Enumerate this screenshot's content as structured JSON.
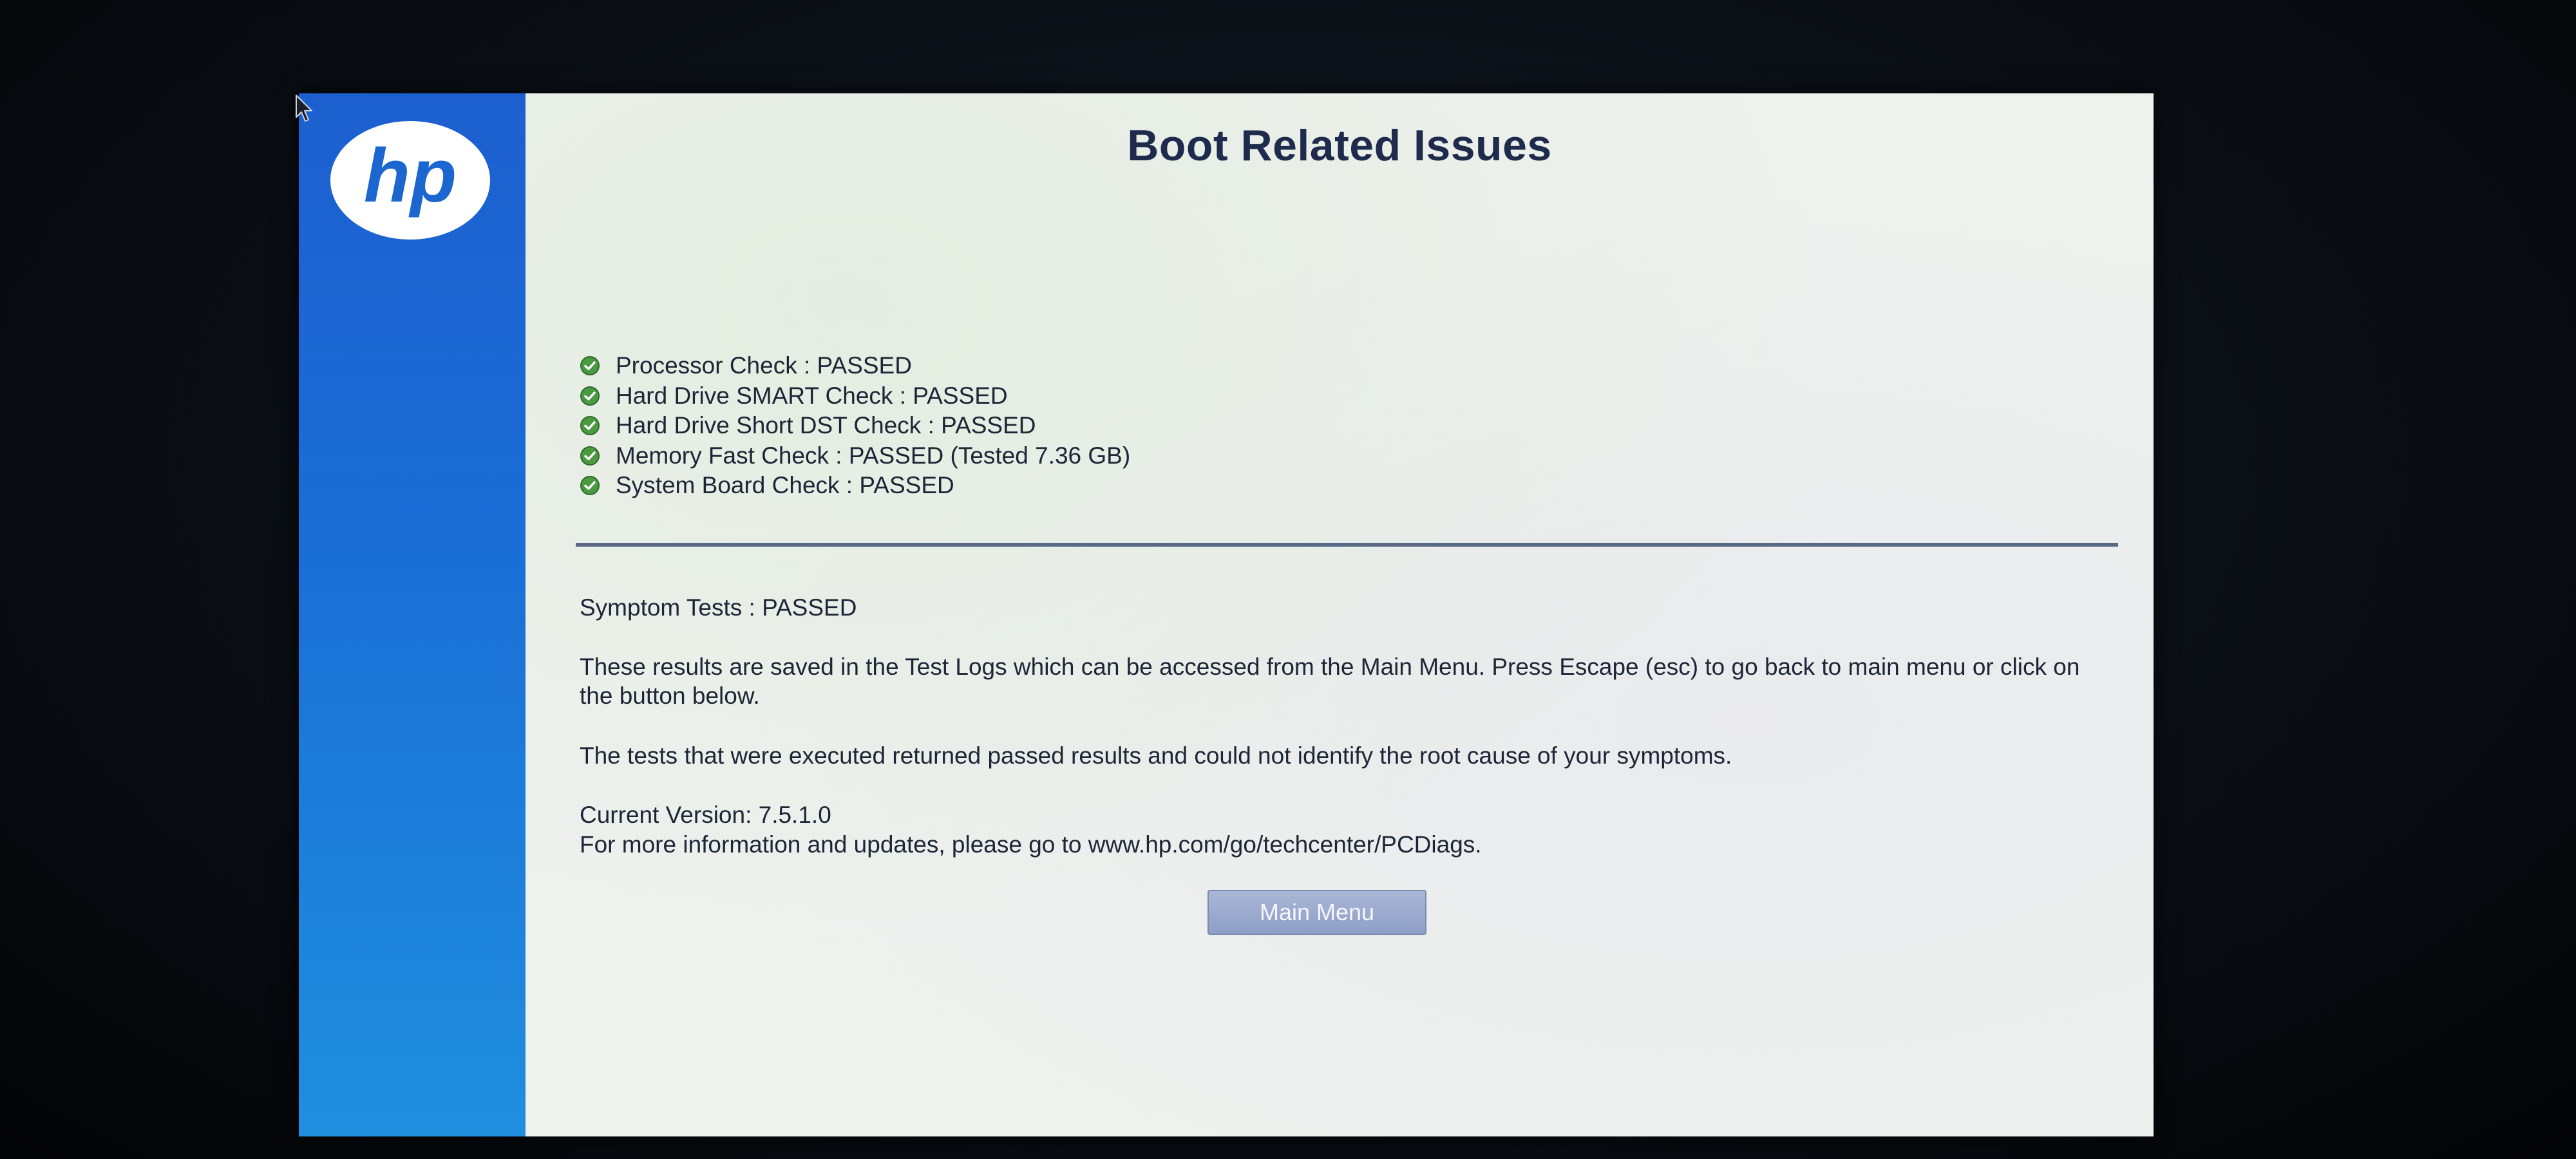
{
  "page": {
    "title": "Boot Related Issues"
  },
  "logo": {
    "icon": "hp-logo-icon",
    "text": "hp"
  },
  "checks": [
    {
      "label": "Processor Check : PASSED",
      "icon": "check-circle-icon"
    },
    {
      "label": "Hard Drive SMART Check : PASSED",
      "icon": "check-circle-icon"
    },
    {
      "label": "Hard Drive Short DST Check : PASSED",
      "icon": "check-circle-icon"
    },
    {
      "label": "Memory Fast Check : PASSED (Tested 7.36 GB)",
      "icon": "check-circle-icon"
    },
    {
      "label": "System Board Check : PASSED",
      "icon": "check-circle-icon"
    }
  ],
  "summary": {
    "symptom_tests": "Symptom Tests : PASSED",
    "saved_message": "These results are saved in the Test Logs which can be accessed from the Main Menu. Press Escape (esc) to go back to main menu or click on the button below.",
    "executed_message": "The tests that were executed returned passed results and could not identify the root cause of your symptoms.",
    "current_version": "Current Version: 7.5.1.0",
    "more_info": "For more information and updates, please go to www.hp.com/go/techcenter/PCDiags."
  },
  "buttons": {
    "main_menu": "Main Menu"
  },
  "colors": {
    "sidebar": "#1a6fd6",
    "title": "#1e2b4d",
    "check_green": "#3f8f3a",
    "button": "#95a5cc"
  }
}
